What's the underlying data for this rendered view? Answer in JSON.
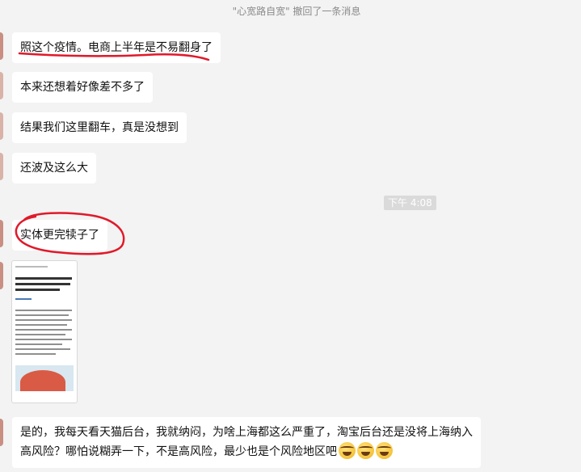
{
  "system_notice": "\"心宽路自宽\" 撤回了一条消息",
  "timestamp": "下午 4:08",
  "messages": [
    {
      "text": "照这个疫情。电商上半年是不易翻身了"
    },
    {
      "text": "本来还想着好像差不多了"
    },
    {
      "text": "结果我们这里翻车，真是没想到"
    },
    {
      "text": "还波及这么大"
    },
    {
      "text": "实体更完犊子了"
    },
    {
      "text": "是的，我每天看天猫后台，我就纳闷，为啥上海都这么严重了，淘宝后台还是没将上海纳入高风险？哪怕说糊弄一下，不是高风险，最少也是个风险地区吧"
    }
  ],
  "image_message": {
    "type": "image",
    "icon": "screenshot-thumbnail"
  },
  "emoji": {
    "name": "laughing-crying-emoji",
    "count": 3
  },
  "colors": {
    "background": "#f3f3f3",
    "bubble": "#ffffff",
    "annotation": "#e0192a",
    "timestamp_bg": "#dadada"
  }
}
